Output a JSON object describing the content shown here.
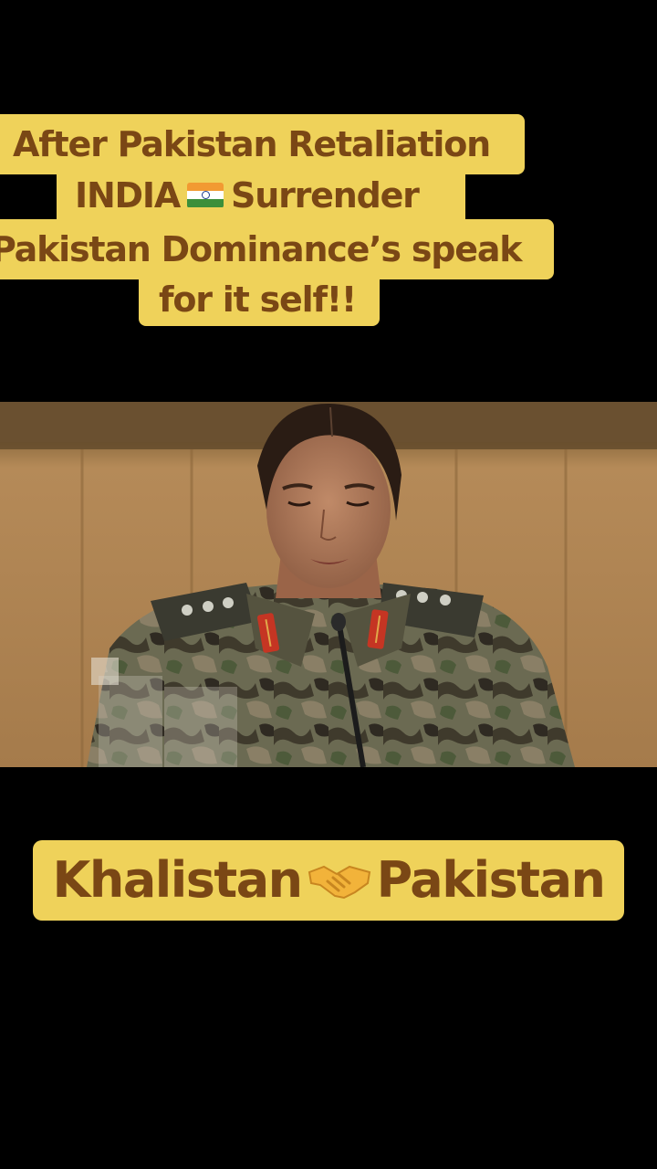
{
  "top_caption": {
    "line1": "After Pakistan Retaliation",
    "line2_pre": "INDIA",
    "line2_icon": "india-flag-icon",
    "line2_post": "Surrender",
    "line3": "Pakistan Dominance’s speak",
    "line4": "for it self!!"
  },
  "bottom_caption": {
    "left": "Khalistan",
    "icon": "handshake-icon",
    "right": "Pakistan"
  },
  "colors": {
    "background": "#000000",
    "caption_bg": "#efd25a",
    "caption_text": "#7a4715"
  }
}
